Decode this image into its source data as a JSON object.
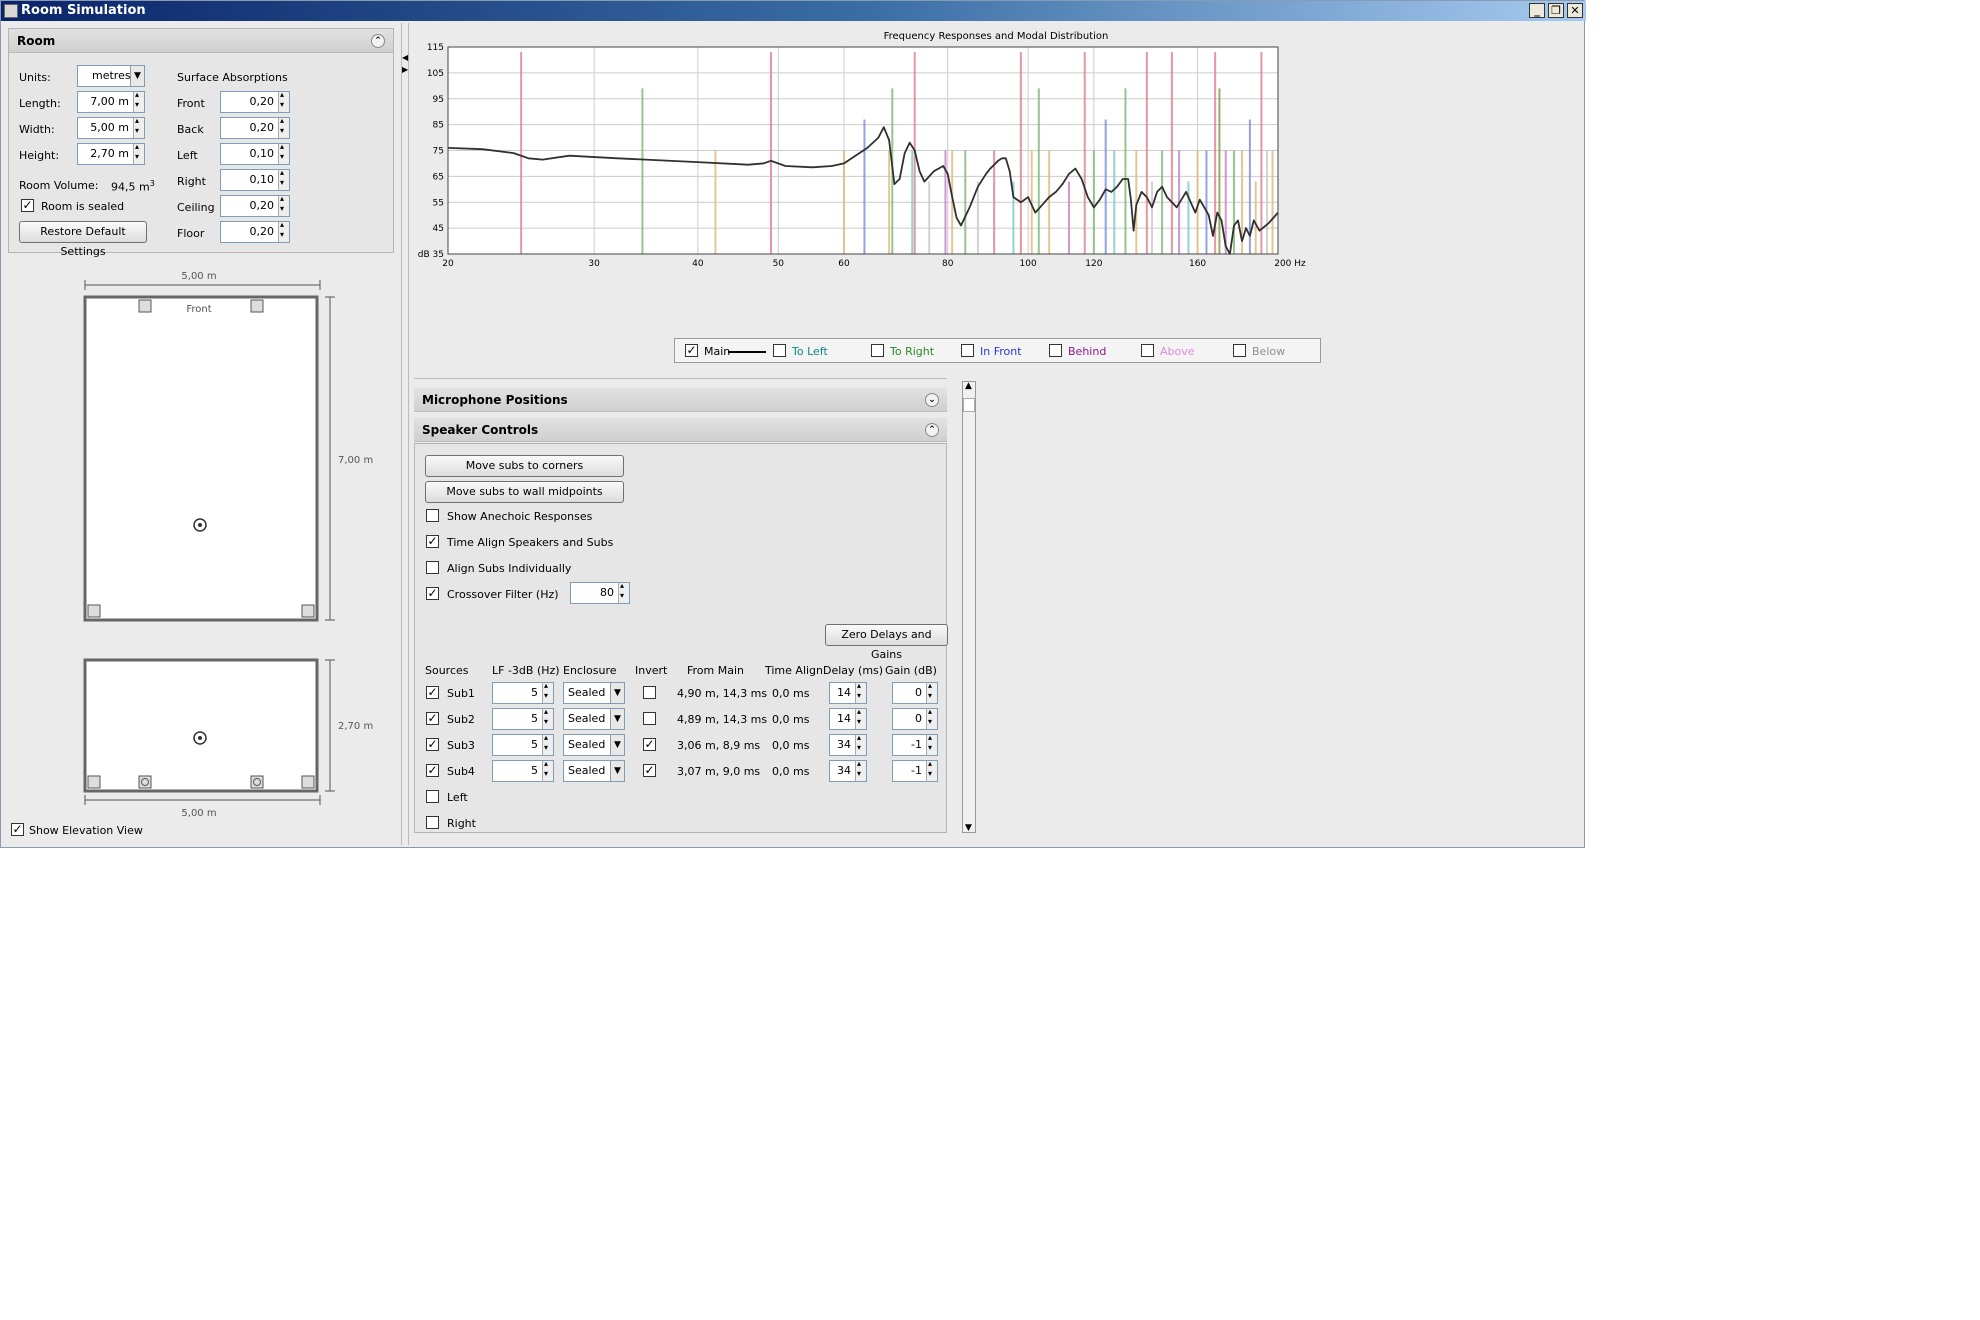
{
  "window": {
    "title": "Room Simulation",
    "buttons": {
      "minimize": "_",
      "restore": "❐",
      "close": "✕"
    }
  },
  "room": {
    "header": "Room",
    "units_label": "Units:",
    "units_value": "metres",
    "length_label": "Length:",
    "length_value": "7,00 m",
    "width_label": "Width:",
    "width_value": "5,00 m",
    "height_label": "Height:",
    "height_value": "2,70 m",
    "volume_label": "Room Volume:",
    "volume_value": "94,5 m",
    "volume_exp": "3",
    "sealed_label": "Room is sealed",
    "sealed_checked": true,
    "restore_button": "Restore Default Settings",
    "surface_title": "Surface Absorptions",
    "surfaces": [
      {
        "label": "Front",
        "value": "0,20"
      },
      {
        "label": "Back",
        "value": "0,20"
      },
      {
        "label": "Left",
        "value": "0,10"
      },
      {
        "label": "Right",
        "value": "0,10"
      },
      {
        "label": "Ceiling",
        "value": "0,20"
      },
      {
        "label": "Floor",
        "value": "0,20"
      }
    ]
  },
  "plan": {
    "top_dim": "5,00 m",
    "front_label": "Front",
    "side_dim": "7,00 m",
    "elev_side_dim": "2,70 m",
    "elev_bottom_dim": "5,00 m",
    "elevation_label": "Show Elevation View",
    "elevation_checked": true
  },
  "chart_data": {
    "type": "line",
    "title": "Frequency Responses and Modal Distribution",
    "xlabel": "Hz",
    "ylabel": "dB",
    "ylim": [
      35,
      115
    ],
    "xlim": [
      20,
      200
    ],
    "xscale": "log",
    "xticks": [
      "20",
      "30",
      "40",
      "50",
      "60",
      "80",
      "100",
      "120",
      "160",
      "200 Hz"
    ],
    "xtick_values": [
      20,
      30,
      40,
      50,
      60,
      80,
      100,
      120,
      160,
      200
    ],
    "yticks": [
      "115",
      "105",
      "95",
      "85",
      "75",
      "65",
      "55",
      "45",
      "dB 35"
    ],
    "ytick_values": [
      115,
      105,
      95,
      85,
      75,
      65,
      55,
      45,
      35
    ],
    "grid": true,
    "series": [
      {
        "name": "Main",
        "color": "#303030",
        "points": [
          [
            20,
            76
          ],
          [
            22,
            75.5
          ],
          [
            24,
            74
          ],
          [
            25,
            72
          ],
          [
            26,
            71.5
          ],
          [
            28,
            73
          ],
          [
            32,
            72
          ],
          [
            40,
            70.5
          ],
          [
            46,
            69.5
          ],
          [
            48,
            70
          ],
          [
            49,
            71
          ],
          [
            51,
            69
          ],
          [
            55,
            68.5
          ],
          [
            58,
            69
          ],
          [
            60,
            70
          ],
          [
            64,
            76
          ],
          [
            66,
            80
          ],
          [
            67,
            84
          ],
          [
            68,
            79
          ],
          [
            69,
            62
          ],
          [
            70,
            64
          ],
          [
            71,
            74
          ],
          [
            72,
            78
          ],
          [
            73,
            75
          ],
          [
            74,
            67
          ],
          [
            75,
            63
          ],
          [
            77,
            67
          ],
          [
            79,
            69
          ],
          [
            80,
            66
          ],
          [
            81,
            57
          ],
          [
            82,
            49
          ],
          [
            83,
            46
          ],
          [
            85,
            53
          ],
          [
            87,
            61
          ],
          [
            89,
            66
          ],
          [
            90,
            68
          ],
          [
            92,
            71
          ],
          [
            93,
            72
          ],
          [
            94,
            72
          ],
          [
            95,
            67
          ],
          [
            96,
            57
          ],
          [
            98,
            55
          ],
          [
            100,
            57
          ],
          [
            102,
            51
          ],
          [
            104,
            54
          ],
          [
            106,
            57
          ],
          [
            108,
            59
          ],
          [
            110,
            62
          ],
          [
            112,
            66
          ],
          [
            114,
            68
          ],
          [
            116,
            64
          ],
          [
            118,
            57
          ],
          [
            120,
            53
          ],
          [
            122,
            56
          ],
          [
            124,
            60
          ],
          [
            126,
            59
          ],
          [
            128,
            61
          ],
          [
            130,
            64
          ],
          [
            132,
            64
          ],
          [
            133,
            56
          ],
          [
            134,
            44
          ],
          [
            135,
            54
          ],
          [
            137,
            59
          ],
          [
            139,
            57
          ],
          [
            141,
            53
          ],
          [
            143,
            59
          ],
          [
            145,
            61
          ],
          [
            147,
            57
          ],
          [
            149,
            55
          ],
          [
            151,
            53
          ],
          [
            153,
            56
          ],
          [
            155,
            59
          ],
          [
            157,
            55
          ],
          [
            159,
            51
          ],
          [
            161,
            56
          ],
          [
            163,
            53
          ],
          [
            165,
            50
          ],
          [
            167,
            42
          ],
          [
            169,
            51
          ],
          [
            171,
            48
          ],
          [
            173,
            38
          ],
          [
            175,
            34
          ],
          [
            177,
            46
          ],
          [
            179,
            48
          ],
          [
            181,
            40
          ],
          [
            183,
            45
          ],
          [
            185,
            42
          ],
          [
            187,
            48
          ],
          [
            190,
            44
          ],
          [
            195,
            47
          ],
          [
            200,
            51
          ]
        ]
      }
    ],
    "modes": [
      {
        "f": 24.5,
        "color": "#e07a8a",
        "h": 113
      },
      {
        "f": 34.3,
        "color": "#7ab872",
        "h": 99
      },
      {
        "f": 42,
        "color": "#e0b878",
        "h": 75
      },
      {
        "f": 49,
        "color": "#e07a8a",
        "h": 113
      },
      {
        "f": 60,
        "color": "#e0b878",
        "h": 75
      },
      {
        "f": 63.5,
        "color": "#7a8ae0",
        "h": 87
      },
      {
        "f": 68,
        "color": "#e0b878",
        "h": 75
      },
      {
        "f": 68.6,
        "color": "#7ab872",
        "h": 99
      },
      {
        "f": 73,
        "color": "#e07a8a",
        "h": 113
      },
      {
        "f": 72.5,
        "color": "#7ac8c8",
        "h": 75
      },
      {
        "f": 76,
        "color": "#c8c8c8",
        "h": 63
      },
      {
        "f": 79.5,
        "color": "#c87ac8",
        "h": 75
      },
      {
        "f": 81,
        "color": "#e0b878",
        "h": 75
      },
      {
        "f": 84,
        "color": "#7ab872",
        "h": 75
      },
      {
        "f": 87,
        "color": "#c8c8c8",
        "h": 63
      },
      {
        "f": 91,
        "color": "#e07a8a",
        "h": 75
      },
      {
        "f": 96,
        "color": "#7ac8c8",
        "h": 63
      },
      {
        "f": 98,
        "color": "#e07a8a",
        "h": 113
      },
      {
        "f": 101,
        "color": "#e0b878",
        "h": 75
      },
      {
        "f": 103,
        "color": "#7ab872",
        "h": 99
      },
      {
        "f": 106,
        "color": "#e0b878",
        "h": 75
      },
      {
        "f": 112,
        "color": "#c87ac8",
        "h": 63
      },
      {
        "f": 117,
        "color": "#e07a8a",
        "h": 113
      },
      {
        "f": 120,
        "color": "#7ab872",
        "h": 75
      },
      {
        "f": 124,
        "color": "#7a8ae0",
        "h": 87
      },
      {
        "f": 127,
        "color": "#7ac8c8",
        "h": 75
      },
      {
        "f": 131,
        "color": "#7ab872",
        "h": 99
      },
      {
        "f": 135,
        "color": "#e0b878",
        "h": 75
      },
      {
        "f": 139,
        "color": "#e07a8a",
        "h": 113
      },
      {
        "f": 141,
        "color": "#c8c8c8",
        "h": 63
      },
      {
        "f": 145,
        "color": "#7ab872",
        "h": 75
      },
      {
        "f": 149,
        "color": "#e07a8a",
        "h": 113
      },
      {
        "f": 152,
        "color": "#c87ac8",
        "h": 75
      },
      {
        "f": 156,
        "color": "#7ac8c8",
        "h": 63
      },
      {
        "f": 160,
        "color": "#e0b878",
        "h": 75
      },
      {
        "f": 164,
        "color": "#7a8ae0",
        "h": 75
      },
      {
        "f": 168,
        "color": "#e07a8a",
        "h": 113
      },
      {
        "f": 170,
        "color": "#7a9a3a",
        "h": 99
      },
      {
        "f": 173,
        "color": "#c87ac8",
        "h": 75
      },
      {
        "f": 177,
        "color": "#7ab872",
        "h": 75
      },
      {
        "f": 181,
        "color": "#e0b878",
        "h": 75
      },
      {
        "f": 185,
        "color": "#7a8ae0",
        "h": 87
      },
      {
        "f": 188,
        "color": "#e0b878",
        "h": 63
      },
      {
        "f": 191,
        "color": "#e07a8a",
        "h": 113
      },
      {
        "f": 194,
        "color": "#c8c8c8",
        "h": 75
      },
      {
        "f": 197,
        "color": "#e0b878",
        "h": 75
      }
    ]
  },
  "legend": [
    {
      "label": "Main",
      "color": "#000000",
      "checked": true
    },
    {
      "label": "To Left",
      "color": "#0a8a8a",
      "checked": false
    },
    {
      "label": "To Right",
      "color": "#2a8a2a",
      "checked": false
    },
    {
      "label": "In Front",
      "color": "#2a3ad0",
      "checked": false
    },
    {
      "label": "Behind",
      "color": "#8a1a8a",
      "checked": false
    },
    {
      "label": "Above",
      "color": "#e08ae0",
      "checked": false
    },
    {
      "label": "Below",
      "color": "#909090",
      "checked": false
    }
  ],
  "mic": {
    "header": "Microphone Positions"
  },
  "speaker": {
    "header": "Speaker Controls",
    "btn_corners": "Move subs to corners",
    "btn_mid": "Move subs to wall midpoints",
    "opt_anechoic": "Show Anechoic Responses",
    "opt_anechoic_checked": false,
    "opt_time": "Time Align Speakers and Subs",
    "opt_time_checked": true,
    "opt_align": "Align Subs Individually",
    "opt_align_checked": false,
    "opt_cross": "Crossover Filter (Hz)",
    "opt_cross_checked": true,
    "cross_value": "80",
    "zero_button": "Zero Delays and Gains",
    "cols": [
      "Sources",
      "LF -3dB (Hz)",
      "Enclosure",
      "Invert",
      "From Main",
      "Time Align",
      "Delay (ms)",
      "Gain (dB)"
    ],
    "rows": [
      {
        "name": "Sub1",
        "on": true,
        "lf": "5",
        "enc": "Sealed",
        "inv": false,
        "from": "4,90 m, 14,3 ms",
        "ta": "0,0 ms",
        "delay": "14",
        "gain": "0"
      },
      {
        "name": "Sub2",
        "on": true,
        "lf": "5",
        "enc": "Sealed",
        "inv": false,
        "from": "4,89 m, 14,3 ms",
        "ta": "0,0 ms",
        "delay": "14",
        "gain": "0"
      },
      {
        "name": "Sub3",
        "on": true,
        "lf": "5",
        "enc": "Sealed",
        "inv": true,
        "from": "3,06 m, 8,9 ms",
        "ta": "0,0 ms",
        "delay": "34",
        "gain": "-1"
      },
      {
        "name": "Sub4",
        "on": true,
        "lf": "5",
        "enc": "Sealed",
        "inv": true,
        "from": "3,07 m, 9,0 ms",
        "ta": "0,0 ms",
        "delay": "34",
        "gain": "-1"
      }
    ],
    "extra": [
      {
        "name": "Left",
        "on": false
      },
      {
        "name": "Right",
        "on": false
      }
    ]
  }
}
